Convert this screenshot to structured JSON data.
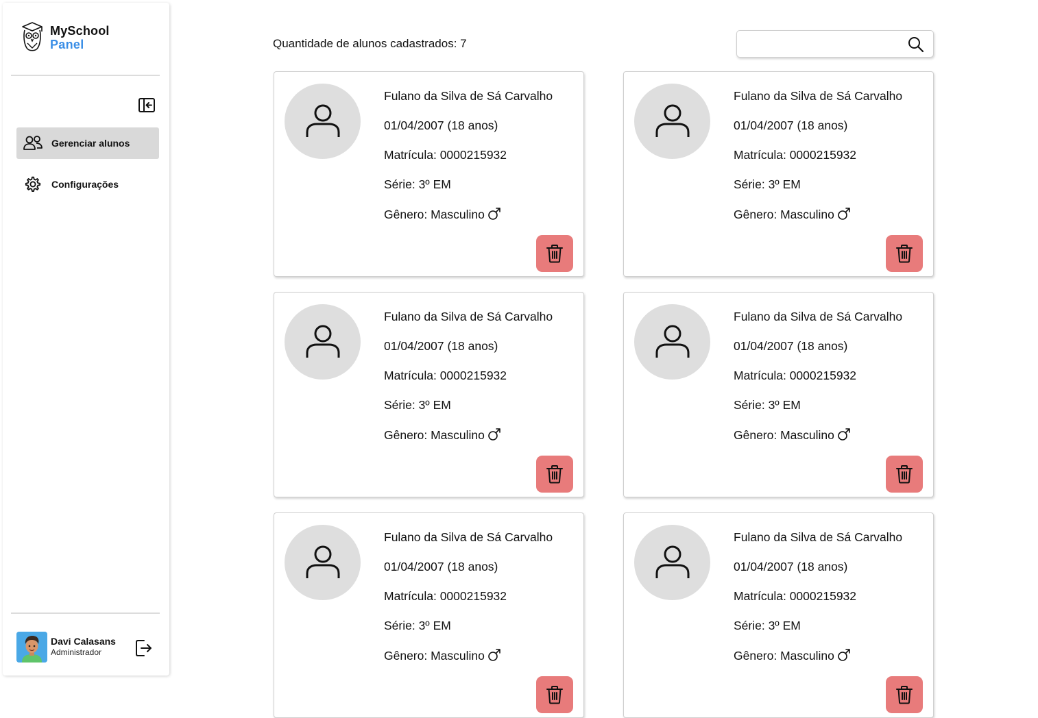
{
  "brand": {
    "line1": "MySchool",
    "line2": "Panel",
    "accent": "#3a8ee6"
  },
  "sidebar": {
    "collapse_icon": "sidebar-collapse-icon",
    "items": [
      {
        "label": "Gerenciar alunos",
        "icon": "users-icon",
        "active": true
      },
      {
        "label": "Configurações",
        "icon": "gear-icon",
        "active": false
      }
    ]
  },
  "user": {
    "name": "Davi Calasans",
    "role": "Administrador",
    "logout_icon": "logout-icon"
  },
  "main": {
    "count_label": "Quantidade de alunos cadastrados: 7",
    "search": {
      "value": "",
      "placeholder": "",
      "icon": "search-icon"
    }
  },
  "students": [
    {
      "name": "Fulano da Silva de Sá Carvalho",
      "birth": "01/04/2007 (18 anos)",
      "matricula": "Matrícula: 0000215932",
      "serie": "Série: 3º EM",
      "genero": "Gênero: Masculino"
    },
    {
      "name": "Fulano da Silva de Sá Carvalho",
      "birth": "01/04/2007 (18 anos)",
      "matricula": "Matrícula: 0000215932",
      "serie": "Série: 3º EM",
      "genero": "Gênero: Masculino"
    },
    {
      "name": "Fulano da Silva de Sá Carvalho",
      "birth": "01/04/2007 (18 anos)",
      "matricula": "Matrícula: 0000215932",
      "serie": "Série: 3º EM",
      "genero": "Gênero: Masculino"
    },
    {
      "name": "Fulano da Silva de Sá Carvalho",
      "birth": "01/04/2007 (18 anos)",
      "matricula": "Matrícula: 0000215932",
      "serie": "Série: 3º EM",
      "genero": "Gênero: Masculino"
    },
    {
      "name": "Fulano da Silva de Sá Carvalho",
      "birth": "01/04/2007 (18 anos)",
      "matricula": "Matrícula: 0000215932",
      "serie": "Série: 3º EM",
      "genero": "Gênero: Masculino"
    },
    {
      "name": "Fulano da Silva de Sá Carvalho",
      "birth": "01/04/2007 (18 anos)",
      "matricula": "Matrícula: 0000215932",
      "serie": "Série: 3º EM",
      "genero": "Gênero: Masculino"
    }
  ],
  "colors": {
    "delete_button": "#e87b7b",
    "active_nav": "#d9d9d9",
    "avatar_bg": "#dedede"
  }
}
